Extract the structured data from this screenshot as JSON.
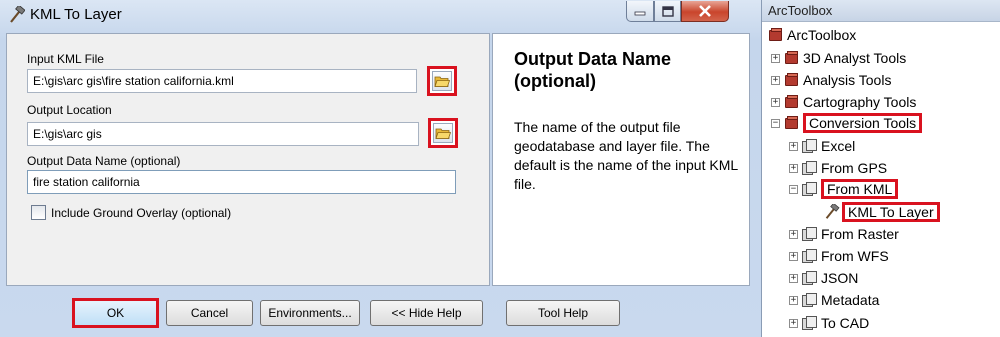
{
  "dialog": {
    "title": "KML To Layer",
    "icon": "hammer-icon",
    "window_controls": [
      "minimize-icon",
      "maximize-icon",
      "close-icon"
    ],
    "fields": {
      "input_kml": {
        "label": "Input KML File",
        "value": "E:\\gis\\arc gis\\fire station california.kml"
      },
      "output_location": {
        "label": "Output Location",
        "value": "E:\\gis\\arc gis"
      },
      "output_name": {
        "label": "Output Data Name (optional)",
        "value": "fire station california"
      },
      "ground_overlay": {
        "label": "Include Ground Overlay (optional)",
        "checked": false
      }
    },
    "buttons": {
      "ok": "OK",
      "cancel": "Cancel",
      "environments": "Environments...",
      "hide_help": "<< Hide Help",
      "tool_help": "Tool Help"
    },
    "help": {
      "title": "Output Data Name (optional)",
      "body": "The name of the output file geodatabase and layer file. The default is the name of the input KML file."
    }
  },
  "toolbox": {
    "panel_title": "ArcToolbox",
    "root": "ArcToolbox",
    "toolboxes": {
      "t3d": "3D Analyst Tools",
      "analysis": "Analysis Tools",
      "cartography": "Cartography Tools",
      "conversion": "Conversion Tools"
    },
    "conversion_sets": {
      "excel": "Excel",
      "gps": "From GPS",
      "kml": "From KML",
      "kml_to_layer": "KML To Layer",
      "raster": "From Raster",
      "wfs": "From WFS",
      "json": "JSON",
      "metadata": "Metadata",
      "cad": "To CAD"
    }
  },
  "colors": {
    "highlight": "#d9121f",
    "window_frame": "#c9d9ee"
  }
}
